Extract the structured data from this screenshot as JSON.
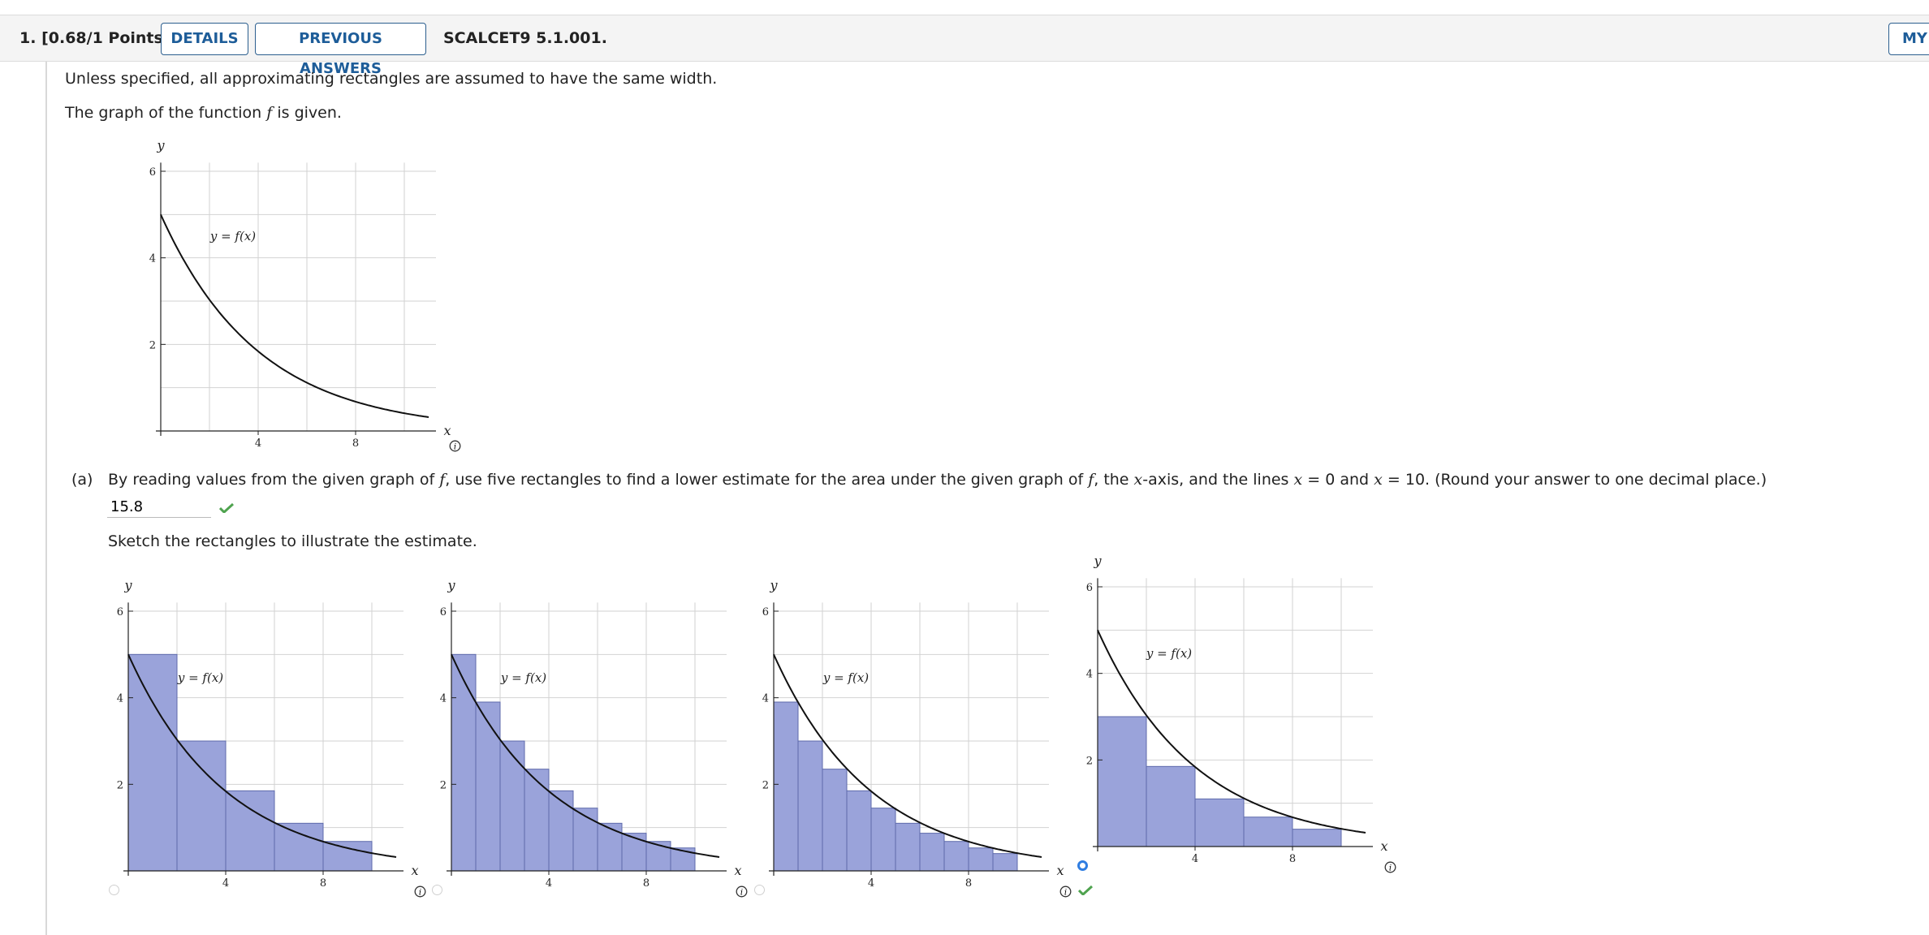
{
  "header": {
    "question_number": "1.",
    "points": "[0.68/1 Points]",
    "details_label": "DETAILS",
    "previous_label": "PREVIOUS ANSWERS",
    "question_id": "SCALCET9 5.1.001.",
    "my_label": "MY"
  },
  "intro": {
    "line1": "Unless specified, all approximating rectangles are assumed to have the same width.",
    "line2_a": "The graph of the function ",
    "line2_f": "f",
    "line2_b": " is given."
  },
  "part_a": {
    "label": "(a)",
    "q1": "By reading values from the given graph of ",
    "f1": "f",
    "q2": ", use five rectangles to find a lower estimate for the area under the given graph of ",
    "f2": "f",
    "q3": ", the ",
    "xvar": "x",
    "q4": "-axis, and the lines ",
    "x1": "x",
    "q5": " = 0 and ",
    "x2": "x",
    "q6": " = 10. (Round your answer to one decimal place.)",
    "answer": "15.8",
    "sketch_prompt": "Sketch the rectangles to illustrate the estimate."
  },
  "graph_labels": {
    "y": "y",
    "x": "x",
    "curve": "y = f(x)",
    "yticks": [
      "2",
      "4",
      "6"
    ],
    "xticks": [
      "4",
      "8"
    ]
  },
  "chart_data": [
    {
      "type": "line",
      "id": "given-graph",
      "function": "f(x) = 5*exp(-0.25x) approx",
      "x": [
        0,
        1,
        2,
        3,
        4,
        5,
        6,
        7,
        8,
        9,
        10
      ],
      "y": [
        5,
        3.9,
        3.0,
        2.35,
        1.85,
        1.45,
        1.1,
        0.87,
        0.68,
        0.53,
        0.4
      ],
      "xlim": [
        0,
        11
      ],
      "ylim": [
        0,
        6
      ]
    },
    {
      "type": "bar",
      "id": "choice-1",
      "x_edges": [
        0,
        2,
        4,
        6,
        8,
        10
      ],
      "values": [
        5,
        3.0,
        1.85,
        1.1,
        0.68
      ],
      "selected": false
    },
    {
      "type": "bar",
      "id": "choice-2",
      "x_edges": [
        0,
        1,
        2,
        3,
        4,
        5,
        6,
        7,
        8,
        9,
        10
      ],
      "values": [
        5,
        3.9,
        3.0,
        2.35,
        1.85,
        1.45,
        1.1,
        0.87,
        0.68,
        0.53
      ],
      "selected": false
    },
    {
      "type": "bar",
      "id": "choice-3",
      "x_edges": [
        0,
        1,
        2,
        3,
        4,
        5,
        6,
        7,
        8,
        9,
        10
      ],
      "values": [
        3.9,
        3.0,
        2.35,
        1.85,
        1.45,
        1.1,
        0.87,
        0.68,
        0.53,
        0.4
      ],
      "selected": false
    },
    {
      "type": "bar",
      "id": "choice-4",
      "x_edges": [
        0,
        2,
        4,
        6,
        8,
        10
      ],
      "values": [
        3.0,
        1.85,
        1.1,
        0.68,
        0.4
      ],
      "selected": true
    }
  ]
}
